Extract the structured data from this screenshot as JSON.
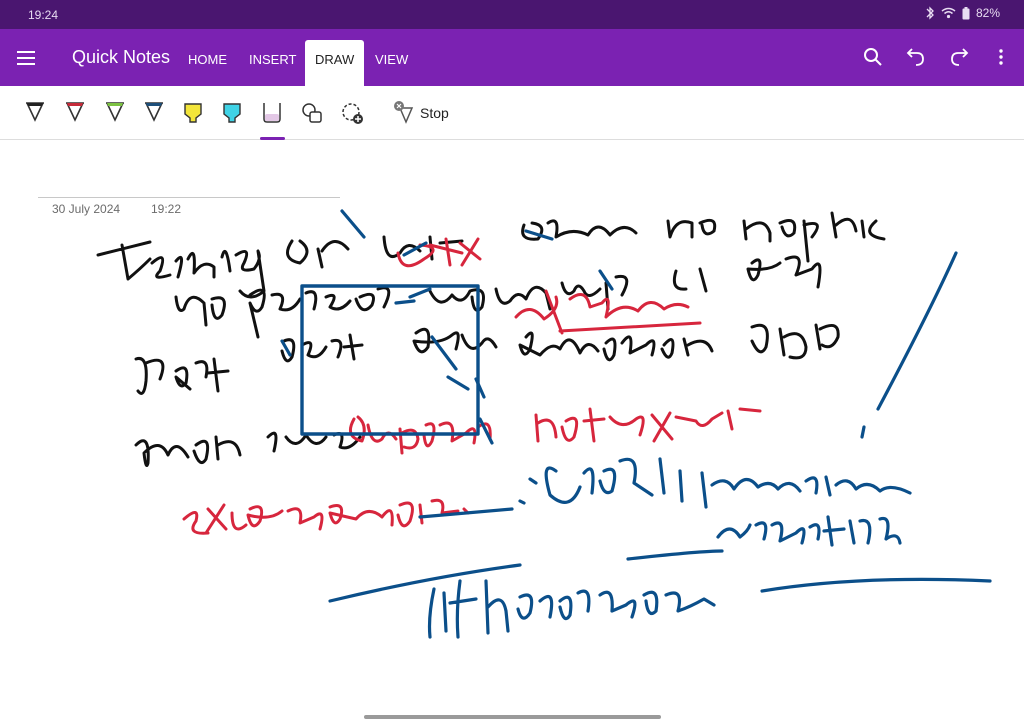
{
  "status": {
    "time": "19:24",
    "battery": "82%",
    "icons": [
      "bluetooth-icon",
      "wifi-icon",
      "battery-icon"
    ]
  },
  "app": {
    "title": "Quick Notes",
    "accent": "#7b22b2",
    "status_bar_color": "#4a1670"
  },
  "tabs": [
    {
      "label": "HOME",
      "active": false
    },
    {
      "label": "INSERT",
      "active": false
    },
    {
      "label": "DRAW",
      "active": true
    },
    {
      "label": "VIEW",
      "active": false
    }
  ],
  "toolbar": {
    "tools": [
      {
        "name": "black-pen",
        "color": "#222222"
      },
      {
        "name": "red-pen",
        "color": "#c62b3a"
      },
      {
        "name": "green-pen",
        "color": "#7cc242"
      },
      {
        "name": "blue-pen",
        "color": "#1d4f7a"
      },
      {
        "name": "yellow-highlighter",
        "color": "#f3e53a"
      },
      {
        "name": "cyan-highlighter",
        "color": "#3fd3e6"
      },
      {
        "name": "eraser",
        "color": "#e3c8e6"
      },
      {
        "name": "shapes"
      },
      {
        "name": "lasso-select"
      }
    ],
    "stop_label": "Stop"
  },
  "page": {
    "date": "30 July 2024",
    "time": "19:22"
  },
  "ink_colors": {
    "black": "#111111",
    "red": "#d7263d",
    "blue": "#0b4f8a"
  }
}
